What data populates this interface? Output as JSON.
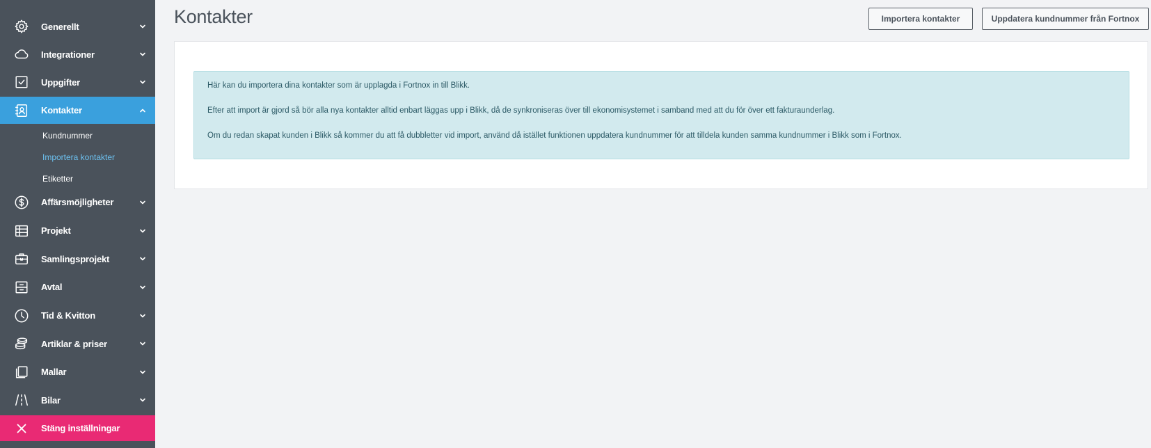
{
  "sidebar": {
    "items": [
      {
        "label": "Generellt",
        "icon": "gear-icon"
      },
      {
        "label": "Integrationer",
        "icon": "cloud-icon"
      },
      {
        "label": "Uppgifter",
        "icon": "checkbox-icon"
      },
      {
        "label": "Kontakter",
        "icon": "contact-book-icon",
        "active": true
      },
      {
        "label": "Affärsmöjligheter",
        "icon": "dollar-circle-icon"
      },
      {
        "label": "Projekt",
        "icon": "table-icon"
      },
      {
        "label": "Samlingsprojekt",
        "icon": "briefcase-icon"
      },
      {
        "label": "Avtal",
        "icon": "archive-icon"
      },
      {
        "label": "Tid & Kvitton",
        "icon": "clock-icon"
      },
      {
        "label": "Artiklar & priser",
        "icon": "coins-icon"
      },
      {
        "label": "Mallar",
        "icon": "copy-icon"
      },
      {
        "label": "Bilar",
        "icon": "road-icon"
      }
    ],
    "sub_items": [
      {
        "label": "Kundnummer"
      },
      {
        "label": "Importera kontakter",
        "current": true
      },
      {
        "label": "Etiketter"
      }
    ],
    "close_label": "Stäng inställningar"
  },
  "header": {
    "title": "Kontakter",
    "import_button": "Importera kontakter",
    "update_button": "Uppdatera kundnummer från Fortnox"
  },
  "info": {
    "line1": "Här kan du importera dina kontakter som är upplagda i Fortnox in till Blikk.",
    "line2": "Efter att import är gjord så bör alla nya kontakter alltid enbart läggas upp i Blikk, då de synkroniseras över till ekonomisystemet i samband med att du för över ett fakturaunderlag.",
    "line3": "Om du redan skapat kunden i Blikk så kommer du att få dubbletter vid import, använd då istället funktionen uppdatera kundnummer för att tilldela kunden samma kundnummer i Blikk som i Fortnox."
  },
  "colors": {
    "sidebar": "#4a525b",
    "active": "#3aa0dd",
    "close": "#e92a74",
    "alert_bg": "#d2eaee"
  }
}
